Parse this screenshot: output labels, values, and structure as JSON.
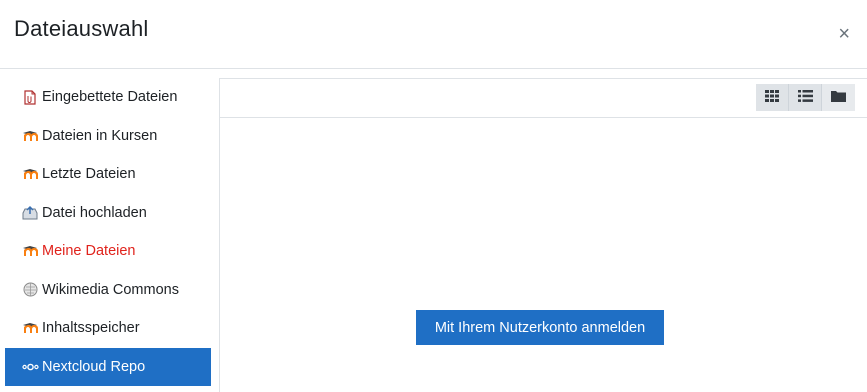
{
  "dialog": {
    "title": "Dateiauswahl",
    "close_glyph": "×"
  },
  "sidebar": {
    "items": [
      {
        "label": "Eingebettete Dateien",
        "icon": "embedded-files-icon"
      },
      {
        "label": "Dateien in Kursen",
        "icon": "moodle-icon"
      },
      {
        "label": "Letzte Dateien",
        "icon": "moodle-icon"
      },
      {
        "label": "Datei hochladen",
        "icon": "upload-icon"
      },
      {
        "label": "Meine Dateien",
        "icon": "moodle-icon",
        "color": "#e0231c"
      },
      {
        "label": "Wikimedia Commons",
        "icon": "wikimedia-icon"
      },
      {
        "label": "Inhaltsspeicher",
        "icon": "moodle-icon"
      },
      {
        "label": "Nextcloud Repo",
        "icon": "nextcloud-icon",
        "active": true
      }
    ]
  },
  "toolbar": {
    "views": [
      "grid-view-icon",
      "list-view-icon",
      "folder-view-icon"
    ]
  },
  "main": {
    "login_label": "Mit Ihrem Nutzerkonto anmelden"
  },
  "colors": {
    "accent": "#1f6fc5",
    "highlight_text": "#e0231c",
    "moodle_orange": "#f98012"
  }
}
